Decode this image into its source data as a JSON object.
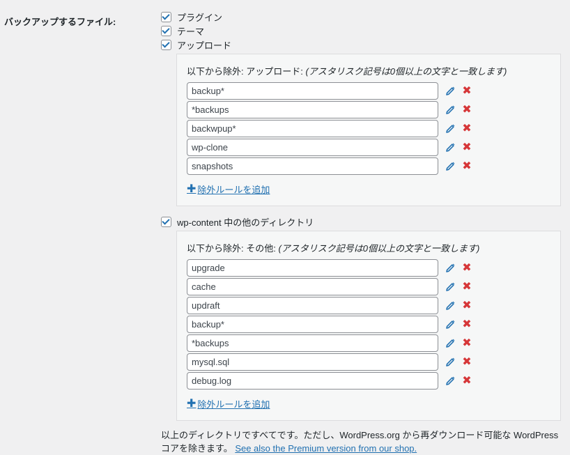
{
  "section_label": "バックアップするファイル:",
  "checkboxes": {
    "plugins": {
      "label": "プラグイン",
      "checked": true
    },
    "themes": {
      "label": "テーマ",
      "checked": true
    },
    "uploads": {
      "label": "アップロード",
      "checked": true
    },
    "others": {
      "label": "wp-content 中の他のディレクトリ",
      "checked": true
    }
  },
  "uploads_box": {
    "heading_prefix": "以下から除外: アップロード: ",
    "heading_note": "(アスタリスク記号は0個以上の文字と一致します)",
    "rules": [
      "backup*",
      "*backups",
      "backwpup*",
      "wp-clone",
      "snapshots"
    ],
    "add_label": "除外ルールを追加"
  },
  "others_box": {
    "heading_prefix": "以下から除外: その他: ",
    "heading_note": "(アスタリスク記号は0個以上の文字と一致します)",
    "rules": [
      "upgrade",
      "cache",
      "updraft",
      "backup*",
      "*backups",
      "mysql.sql",
      "debug.log"
    ],
    "add_label": "除外ルールを追加"
  },
  "footer": {
    "text": "以上のディレクトリですべてです。ただし、WordPress.org から再ダウンロード可能な WordPress コアを除きます。 ",
    "link": "See also the Premium version from our shop."
  },
  "icons": {
    "edit": "pencil-icon",
    "delete": "close-icon",
    "add": "plus-icon"
  },
  "colors": {
    "link": "#2271b1",
    "delete": "#d63638",
    "background": "#f0f0f1"
  }
}
